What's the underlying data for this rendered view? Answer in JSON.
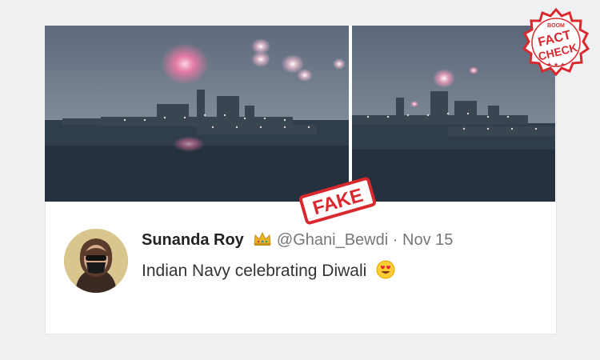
{
  "tweet": {
    "display_name": "Sunanda Roy",
    "handle": "@Ghani_Bewdi",
    "separator": "·",
    "date": "Nov 15",
    "text": "Indian Navy celebrating Diwali",
    "emoji": "smiling-face-with-heart-eyes",
    "badge_icon": "crown-icon"
  },
  "media": {
    "panels": [
      "ship-firework-frame-1",
      "ship-firework-frame-2"
    ]
  },
  "overlays": {
    "fake_stamp": "FAKE",
    "fact_check": {
      "top": "BOOM",
      "line1": "FACT",
      "line2": "CHECK"
    }
  },
  "colors": {
    "stamp_red": "#d8292f",
    "sky": "#6b7a8c",
    "sea": "#2c3a4a"
  }
}
